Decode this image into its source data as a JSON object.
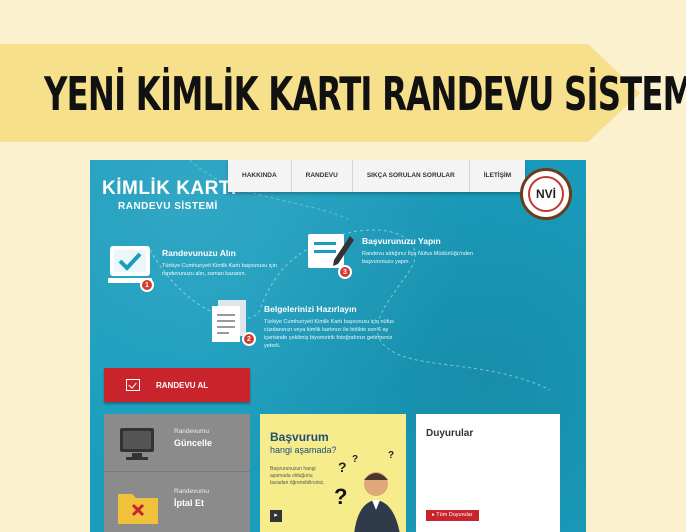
{
  "banner": {
    "title": "YENİ KİMLİK KARTI RANDEVU SİSTEMİ",
    "color": "#f7e08c"
  },
  "site": {
    "logo": {
      "line1": "KİMLİK KARTI",
      "line2": "RANDEVU SİSTEMİ"
    },
    "nav": [
      "HAKKINDA",
      "RANDEVU",
      "SIKÇA SORULAN SORULAR",
      "İLETİŞİM"
    ],
    "emblem": "NVİ",
    "steps": [
      {
        "number": "1",
        "title": "Randevunuzu Alın",
        "desc": "Türkiye Cumhuriyeti Kimlik Kartı başvurusu için randevunuzu alın, zaman kazanın.",
        "icon": "monitor-check-icon"
      },
      {
        "number": "2",
        "title": "Belgelerinizi Hazırlayın",
        "desc": "Türkiye Cumhuriyeti Kimlik Kartı başvurusu için nüfus cüzdanınızı veya kimlik kartınızı ile birlikte son 6 ay içerisinde çekilmiş biyometrik fotoğrafınızı getirmeniz yeterli.",
        "icon": "documents-icon"
      },
      {
        "number": "3",
        "title": "Başvurunuzu Yapın",
        "desc": "Randevu aldığınız İlçe Nüfus Müdürlüğü'nden başvurunuzu yapın.",
        "icon": "pen-form-icon"
      }
    ],
    "cta_label": "RANDEVU AL",
    "gray_panel": [
      {
        "small": "Randevumu",
        "large": "Güncelle",
        "icon": "monitor-icon"
      },
      {
        "small": "Randevumu",
        "large": "İptal Et",
        "icon": "folder-x-icon"
      }
    ],
    "yellow_panel": {
      "title": "Başvurum",
      "subtitle": "hangi aşamada?",
      "desc": "Başvurunuzun hangi aşamada olduğunu buradan öğrenebilirsiniz."
    },
    "white_panel": {
      "title": "Duyurular",
      "button": "Tüm Duyurular"
    }
  }
}
